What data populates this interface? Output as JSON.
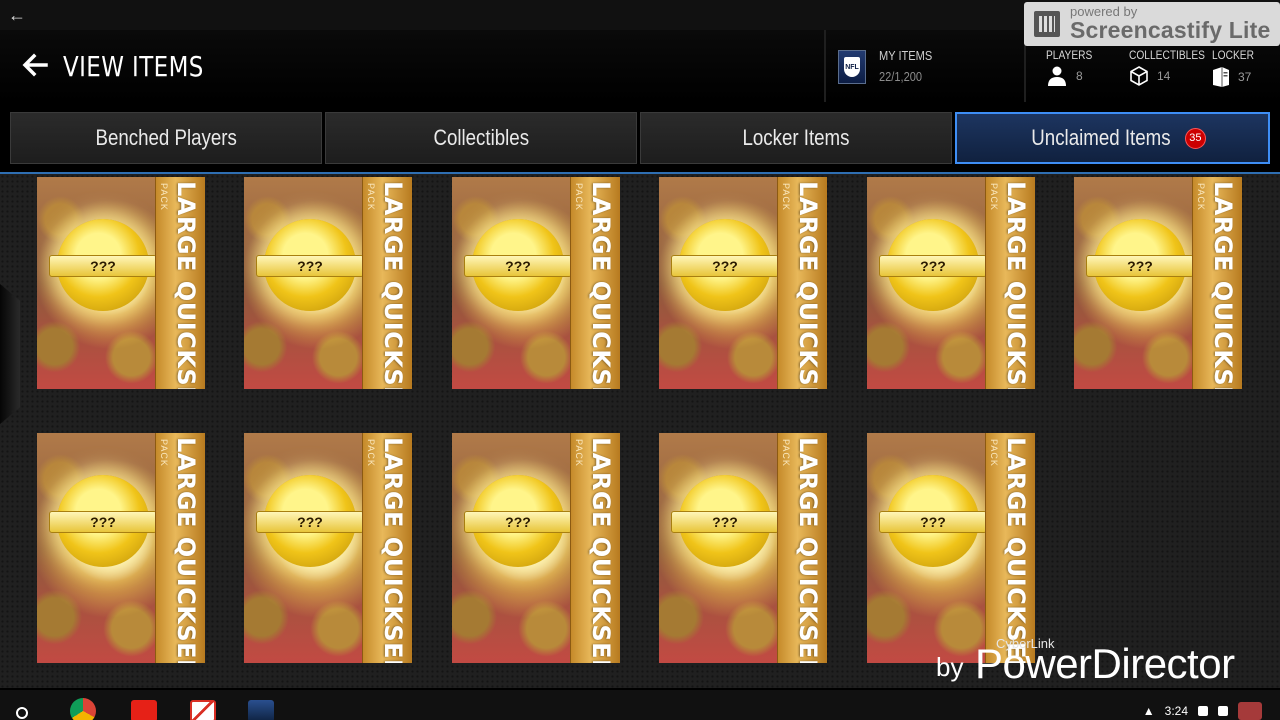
{
  "header": {
    "title": "VIEW ITEMS",
    "my_items_label": "MY ITEMS",
    "my_items_value": "22/1,200",
    "stats": [
      {
        "label": "PLAYERS",
        "value": "8",
        "icon": "person-icon"
      },
      {
        "label": "COLLECTIBLES",
        "value": "14",
        "icon": "cube-icon"
      },
      {
        "label": "LOCKER",
        "value": "37",
        "icon": "locker-icon"
      }
    ]
  },
  "tabs": [
    {
      "label": "Benched Players",
      "active": false
    },
    {
      "label": "Collectibles",
      "active": false
    },
    {
      "label": "Locker Items",
      "active": false
    },
    {
      "label": "Unclaimed Items",
      "active": true,
      "badge": "35"
    }
  ],
  "items": [
    {
      "title": "LARGE QUICKSELL",
      "subtitle": "PACK",
      "coin_text": "???"
    },
    {
      "title": "LARGE QUICKSELL",
      "subtitle": "PACK",
      "coin_text": "???"
    },
    {
      "title": "LARGE QUICKSELL",
      "subtitle": "PACK",
      "coin_text": "???"
    },
    {
      "title": "LARGE QUICKSELL",
      "subtitle": "PACK",
      "coin_text": "???"
    },
    {
      "title": "LARGE QUICKSELL",
      "subtitle": "PACK",
      "coin_text": "???"
    },
    {
      "title": "LARGE QUICKSELL",
      "subtitle": "PACK",
      "coin_text": "???"
    },
    {
      "title": "LARGE QUICKSELL",
      "subtitle": "PACK",
      "coin_text": "???"
    },
    {
      "title": "LARGE QUICKSELL",
      "subtitle": "PACK",
      "coin_text": "???"
    },
    {
      "title": "LARGE QUICKSELL",
      "subtitle": "PACK",
      "coin_text": "???"
    },
    {
      "title": "LARGE QUICKSELL",
      "subtitle": "PACK",
      "coin_text": "???"
    },
    {
      "title": "LARGE QUICKSELL",
      "subtitle": "PACK",
      "coin_text": "???"
    }
  ],
  "watermarks": {
    "screencastify_powered": "powered by",
    "screencastify_name": "Screencastify Lite",
    "cyberlink": "CyberLink",
    "by": "by",
    "powerdirector": "PowerDirector"
  },
  "shelf": {
    "clock": "3:24",
    "apps": [
      "chrome-icon",
      "youtube-icon",
      "gmail-icon",
      "game-app-icon"
    ]
  },
  "colors": {
    "accent": "#3e8ef5",
    "badge": "#cc0000",
    "card_gold": "#e8b85a"
  }
}
